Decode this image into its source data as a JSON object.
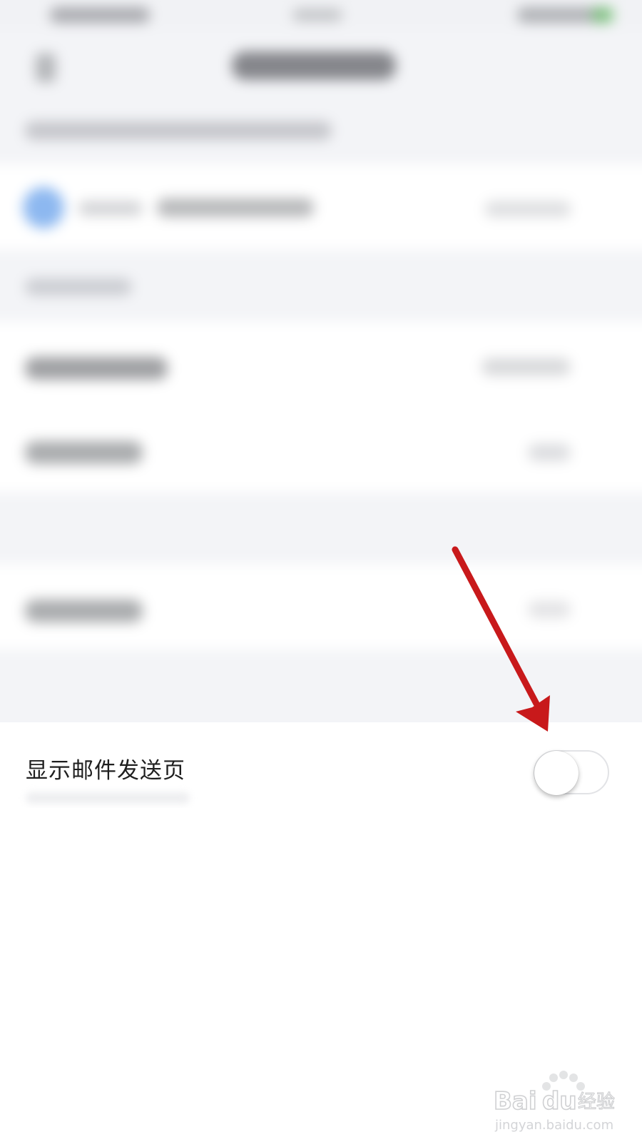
{
  "setting": {
    "label": "显示邮件发送页",
    "toggle_on": false
  },
  "annotation": {
    "arrow_color": "#c8191b"
  },
  "watermark": {
    "brand": "Baidu经验",
    "url": "jingyan.baidu.com"
  }
}
